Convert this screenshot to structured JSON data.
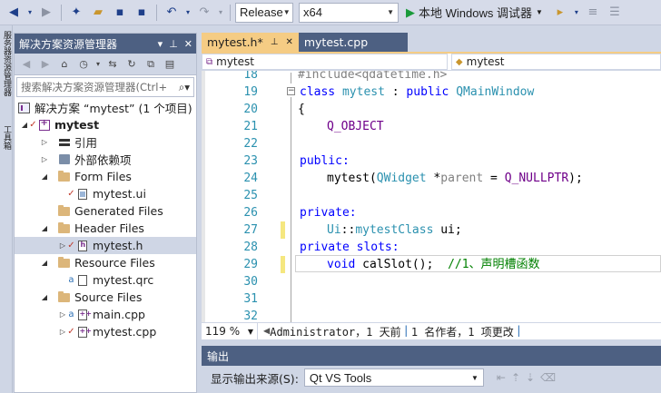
{
  "toolbar": {
    "configuration": "Release",
    "platform": "x64",
    "run_label": "本地 Windows 调试器"
  },
  "vertical_tabs": [
    "服务器资源管理器",
    "工具箱"
  ],
  "solution_explorer": {
    "title": "解决方案资源管理器",
    "title_controls": [
      "▾",
      "⊥",
      "✕"
    ],
    "search_placeholder": "搜索解决方案资源管理器(Ctrl+",
    "items": [
      {
        "label": "解决方案 “mytest” (1 个项目)",
        "icon": "solution-icon"
      },
      {
        "label": "mytest",
        "icon": "project-icon"
      },
      {
        "label": "引用",
        "icon": "references-icon"
      },
      {
        "label": "外部依赖项",
        "icon": "external-deps-icon"
      },
      {
        "label": "Form Files",
        "icon": "folder-icon"
      },
      {
        "label": "mytest.ui",
        "icon": "ui-file-icon"
      },
      {
        "label": "Generated Files",
        "icon": "folder-icon"
      },
      {
        "label": "Header Files",
        "icon": "folder-icon"
      },
      {
        "label": "mytest.h",
        "icon": "header-file-icon"
      },
      {
        "label": "Resource Files",
        "icon": "folder-icon"
      },
      {
        "label": "mytest.qrc",
        "icon": "file-icon"
      },
      {
        "label": "Source Files",
        "icon": "folder-icon"
      },
      {
        "label": "main.cpp",
        "icon": "cpp-file-icon"
      },
      {
        "label": "mytest.cpp",
        "icon": "cpp-file-icon"
      }
    ]
  },
  "editor": {
    "tabs": [
      {
        "label": "mytest.h*",
        "pin": "⊥",
        "close": "✕"
      },
      {
        "label": "mytest.cpp"
      }
    ],
    "nav_left": "mytest",
    "nav_right": "mytest",
    "line_numbers": [
      "18",
      "19",
      "20",
      "21",
      "22",
      "23",
      "24",
      "25",
      "26",
      "27",
      "28",
      "29",
      "30",
      "31",
      "32"
    ],
    "code": {
      "l18": "#include<qdatetime.h>",
      "l19_class": "class",
      "l19_name": "mytest",
      "l19_colon": " : ",
      "l19_public": "public",
      "l19_base": "QMainWindow",
      "l20": "{",
      "l21": "Q_OBJECT",
      "l23": "public:",
      "l24_ctor": "mytest(",
      "l24_type": "QWidget",
      "l24_star": " *",
      "l24_param": "parent",
      "l24_eq": " = ",
      "l24_default": "Q_NULLPTR",
      "l24_end": ");",
      "l26": "private:",
      "l27_ns": "Ui",
      "l27_sep": "::",
      "l27_cls": "mytestClass",
      "l27_var": " ui;",
      "l28": "private slots:",
      "l29_void": "void",
      "l29_fn": " calSlot();  ",
      "l29_comment": "//1、声明槽函数"
    },
    "zoom": "119 %",
    "blame": {
      "author": "Administrator，1 天前",
      "authors": "1 名作者，1 项更改"
    }
  },
  "output": {
    "title": "输出",
    "source_label": "显示输出来源(S):",
    "source_value": "Qt VS Tools"
  }
}
